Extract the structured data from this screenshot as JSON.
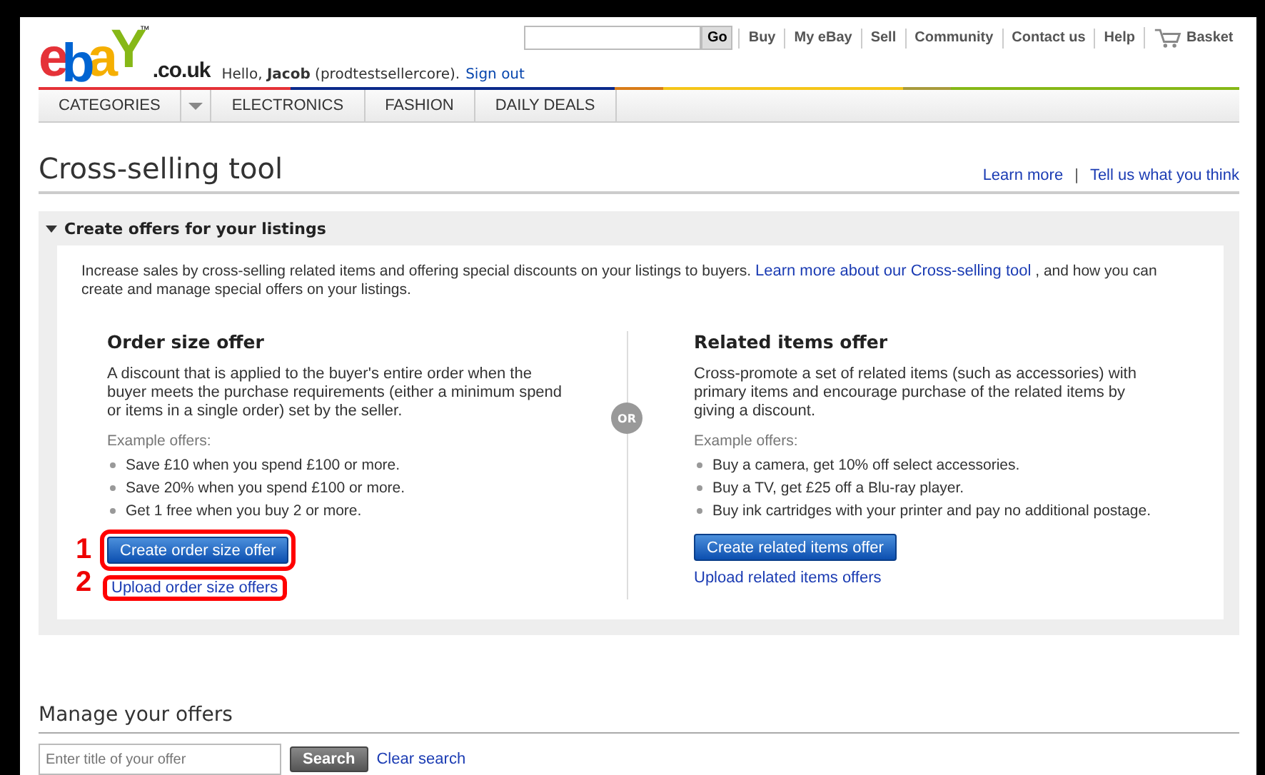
{
  "header": {
    "logo": {
      "letters": [
        "e",
        "b",
        "a",
        "Y"
      ],
      "trademark": "™",
      "domain": ".co.uk"
    },
    "search": {
      "button": "Go"
    },
    "nav": [
      "Buy",
      "My eBay",
      "Sell",
      "Community",
      "Contact us",
      "Help",
      "Basket"
    ],
    "greeting": {
      "text": "Hello, **Jacob** (prodtestsellercore).",
      "link": "Sign out"
    }
  },
  "categories": [
    {
      "kind": "tab",
      "label": "CATEGORIES"
    },
    {
      "kind": "dropdown"
    },
    {
      "kind": "tab",
      "label": "ELECTRONICS"
    },
    {
      "kind": "tab",
      "label": "FASHION"
    },
    {
      "kind": "tab",
      "label": "DAILY DEALS"
    }
  ],
  "page": {
    "title": "Cross-selling tool",
    "links": [
      "Learn more",
      "Tell us what you think"
    ],
    "link_separator": "|"
  },
  "panel": {
    "title": "Create offers for your listings",
    "expanded": true,
    "intro": "Increase sales by cross-selling related items and offering special discounts on your listings to buyers.",
    "intro_link": "Learn more about our Cross-selling tool",
    "intro_end": ", and how you can create and manage special offers on your listings.",
    "separator": "OR",
    "offers": [
      {
        "title": "Order size offer",
        "description": "A discount that is applied to the buyer's entire order when the buyer meets the purchase requirements (either a minimum spend or items in a single order) set by the seller.",
        "examples_label": "Example offers:",
        "examples": [
          "Save £10 when you spend £100 or more.",
          "Save 20% when you spend £100 or more.",
          "Get 1 free when you buy 2 or more."
        ],
        "button": "Create order size offer",
        "link": "Upload order size offers",
        "callouts": [
          "1",
          "2"
        ]
      },
      {
        "title": "Related items offer",
        "description": "Cross-promote a set of related items (such as accessories) with primary items and encourage purchase of the related items by giving a discount.",
        "examples_label": "Example offers:",
        "examples": [
          "Buy a camera, get 10% off select accessories.",
          "Buy a TV, get £25 off a Blu-ray player.",
          "Buy ink cartridges with your printer and pay no additional postage."
        ],
        "button": "Create related items offer",
        "link": "Upload related items offers"
      }
    ]
  },
  "manage": {
    "title": "Manage your offers",
    "search": {
      "placeholder": "Enter title of your offer",
      "button": "Search"
    },
    "clear": "Clear search"
  }
}
